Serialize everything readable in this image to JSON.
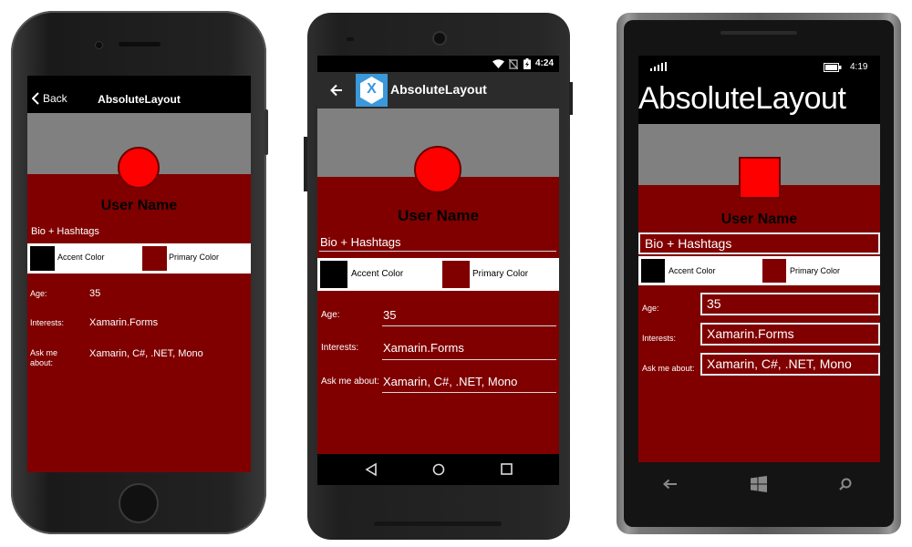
{
  "colors": {
    "header_gray": "#808080",
    "content_red": "#800000",
    "avatar_red": "#ff0000",
    "accent": "#000000",
    "primary": "#800000"
  },
  "ios": {
    "nav": {
      "back_label": "Back",
      "title": "AbsoluteLayout"
    },
    "user_name": "User Name",
    "bio": "Bio + Hashtags",
    "accent_label": "Accent Color",
    "primary_label": "Primary Color",
    "age_label": "Age:",
    "age_value": "35",
    "interests_label": "Interests:",
    "interests_value": "Xamarin.Forms",
    "ask_label": "Ask me about:",
    "ask_value": "Xamarin, C#, .NET, Mono"
  },
  "android": {
    "status": {
      "time": "4:24"
    },
    "toolbar": {
      "title": "AbsoluteLayout",
      "logo_letter": "X"
    },
    "user_name": "User Name",
    "bio": "Bio + Hashtags",
    "accent_label": "Accent Color",
    "primary_label": "Primary Color",
    "age_label": "Age:",
    "age_value": "35",
    "interests_label": "Interests:",
    "interests_value": "Xamarin.Forms",
    "ask_label": "Ask me about:",
    "ask_value": "Xamarin, C#, .NET, Mono"
  },
  "wp": {
    "status": {
      "time": "4:19"
    },
    "title": "AbsoluteLayout",
    "user_name": "User Name",
    "bio": "Bio + Hashtags",
    "accent_label": "Accent Color",
    "primary_label": "Primary Color",
    "age_label": "Age:",
    "age_value": "35",
    "interests_label": "Interests:",
    "interests_value": "Xamarin.Forms",
    "ask_label": "Ask me about:",
    "ask_value": "Xamarin, C#, .NET, Mono"
  }
}
